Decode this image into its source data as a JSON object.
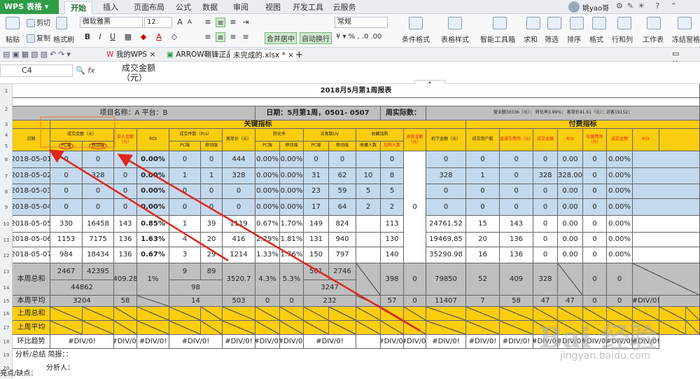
{
  "app": {
    "name": "WPS 表格",
    "user": "姚yao哥"
  },
  "ribbon_tabs": [
    "开始",
    "插入",
    "页面布局",
    "公式",
    "数据",
    "审阅",
    "视图",
    "开发工具",
    "云服务"
  ],
  "ribbon": {
    "cut": "剪切",
    "copy": "复制",
    "format_painter": "格式刷",
    "paste": "粘贴",
    "font": "微软雅黑",
    "size": "12",
    "merge": "合并居中",
    "wrap": "自动换行",
    "number_format": "常规",
    "cond_format": "条件格式",
    "table_style": "表格样式",
    "toolbox": "智能工具箱",
    "sum": "求和",
    "filter": "筛选",
    "sort": "排序",
    "format": "格式",
    "rowcol": "行和列",
    "sheet": "工作表",
    "freeze": "冻结窗格"
  },
  "doc_tabs": [
    {
      "label": "我的WPS"
    },
    {
      "label": "ARROW鞘锋正品"
    },
    {
      "label": "未完成的.xlsx *"
    }
  ],
  "formula": {
    "cell": "C4",
    "fx": "fx",
    "text_line1": "成交金额",
    "text_line2": "（元）"
  },
  "sheet": {
    "title": "2018月5月第1周报表",
    "project": "项目名称：A   平台：B",
    "date": "日期：5月第1周，0501-  0507",
    "actual": "周实际数：",
    "summary": "营业额30336（元）；   转化率3.89%；  客单价41.61（元）；访客19152；",
    "section_key": "关键指标",
    "section_paid": "付费指标",
    "h": {
      "date": "日期",
      "deal_amt": "成交金额（元）",
      "pc": "PC端",
      "mobile": "移动端",
      "ad_amt": "投入金额（元）",
      "roi": "ROI",
      "deal_cnt": "成交件数（Pcs）",
      "aov": "客单价（元）",
      "conv": "转化率",
      "uv": "访客数UV",
      "fav": "收藏加购",
      "fav_cnt": "收藏人数",
      "cart_cnt": "加购人数",
      "refund": "退款金额（元）",
      "pay_amt": "拍下金额（元）",
      "deal_users": "成交用户数",
      "ztc_cost": "直通车费用（元）",
      "deal_amt2": "成交金额",
      "roi2": "ROI",
      "zz_cost": "钻展费用（元）",
      "deal_amt3": "成交金额",
      "roi3": "ROI"
    },
    "rows": [
      {
        "n": "6",
        "date": "2018-05-01",
        "v": [
          "0",
          "0",
          "0",
          "0.00%",
          "0",
          "0",
          "444",
          "0.00%",
          "0.00%",
          "0",
          "0",
          "",
          "0",
          "",
          "0",
          "0",
          "0",
          "0",
          "0.00",
          "0",
          "0.00%"
        ]
      },
      {
        "n": "7",
        "date": "2018-05-02",
        "v": [
          "0",
          "328",
          "0",
          "0.00%",
          "1",
          "1",
          "328",
          "0.00%",
          "0.00%",
          "31",
          "62",
          "10",
          "8",
          "",
          "328",
          "1",
          "0",
          "328",
          "328.00",
          "0",
          "0.00%"
        ]
      },
      {
        "n": "8",
        "date": "2018-05-03",
        "v": [
          "0",
          "0",
          "0",
          "0.00%",
          "0",
          "0",
          "0",
          "0.00%",
          "0.00%",
          "23",
          "59",
          "5",
          "5",
          "",
          "0",
          "0",
          "0",
          "0",
          "0.00",
          "0",
          "0.00%"
        ]
      },
      {
        "n": "9",
        "date": "2018-05-04",
        "v": [
          "0",
          "0",
          "0",
          "0.00%",
          "0",
          "0",
          "0",
          "0.00%",
          "0.00%",
          "17",
          "64",
          "2",
          "2",
          "",
          "0",
          "0",
          "0",
          "0",
          "0.00",
          "0",
          "0.00%"
        ]
      },
      {
        "n": "10",
        "date": "2018-05-05",
        "v": [
          "330",
          "16458",
          "143",
          "0.85%",
          "1",
          "39",
          "1119",
          "0.67%",
          "1.70%",
          "149",
          "824",
          "",
          "113",
          "",
          "24761.52",
          "15",
          "143",
          "0",
          "0.00",
          "0",
          "0.00%"
        ]
      },
      {
        "n": "11",
        "date": "2018-05-06",
        "v": [
          "1153",
          "7175",
          "136",
          "1.63%",
          "4",
          "20",
          "416",
          "2.29%",
          "1.81%",
          "131",
          "940",
          "",
          "130",
          "",
          "19469.85",
          "20",
          "136",
          "0",
          "0.00",
          "0",
          "0.00%"
        ]
      },
      {
        "n": "12",
        "date": "2018-05-07",
        "v": [
          "984",
          "18434",
          "136",
          "0.67%",
          "3",
          "29",
          "1214",
          "1.33%",
          "1.76%",
          "150",
          "797",
          "",
          "140",
          "",
          "35290.98",
          "16",
          "136",
          "0",
          "0.00",
          "0",
          "0.00%"
        ]
      }
    ],
    "refund_merged": "0",
    "total": {
      "label": "本周总和",
      "pc": "2467",
      "mob": "42395",
      "sum": "44862",
      "ad": "409.28",
      "roi": "1%",
      "cnt_pc": "9",
      "cnt_mob": "89",
      "cnt_sum": "98",
      "aov": "3520.7",
      "conv_pc": "4.3%",
      "conv_mob": "5.3%",
      "uv_pc": "501",
      "uv_mob": "2746",
      "uv_sum": "3247",
      "cart": "398",
      "refund": "0",
      "pay": "79850",
      "users": "52",
      "ztc": "409",
      "deal2": "328",
      "roi2": "",
      "zz": "0",
      "deal3": "0"
    },
    "avg": {
      "label": "本周平均",
      "amt": "3204",
      "ad": "58",
      "cnt": "14",
      "aov": "503",
      "c1": "0",
      "c2": "0",
      "uv": "232",
      "cart": "57",
      "refund": "0",
      "pay": "11407",
      "users": "7",
      "ztc": "58",
      "deal2": "47",
      "roi2": "47",
      "zz": "0",
      "deal3": "0",
      "last": "#DIV/0!"
    },
    "last_sum": "上周总和",
    "last_avg": "上周平均",
    "trend": {
      "label": "环比趋势",
      "div": "#DIV/0!"
    },
    "analysis": "分析/总结  简报：：",
    "analyst": "分析人：",
    "highlights": "亮点/缺点："
  },
  "watermark": {
    "big": "Bai 经验",
    "small": "jingyan.baidu.com"
  },
  "colors": {
    "blue": "#c5d9ee",
    "yellow": "#fbcd0f",
    "gray": "#bfbfbf",
    "arrow": "#e0251c",
    "accent": "#2f9d46"
  }
}
